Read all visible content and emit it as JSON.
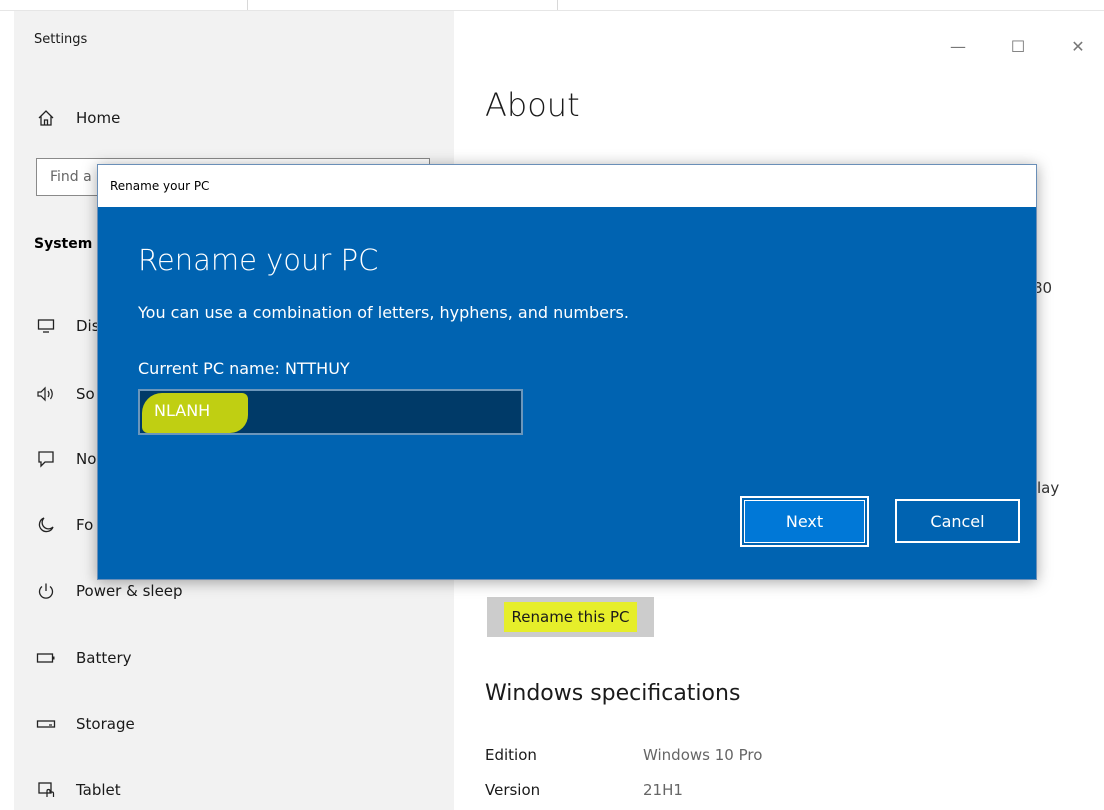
{
  "window": {
    "title": "Settings",
    "minimize_glyph": "—",
    "maximize_glyph": "☐",
    "close_glyph": "✕"
  },
  "sidebar": {
    "home_label": "Home",
    "search_placeholder": "Find a",
    "section_label": "System",
    "items": [
      {
        "label": "Display",
        "visible": "Dis",
        "icon": "monitor-icon"
      },
      {
        "label": "Sound",
        "visible": "So",
        "icon": "speaker-icon"
      },
      {
        "label": "Notifications",
        "visible": "No",
        "icon": "notification-icon"
      },
      {
        "label": "Focus assist",
        "visible": "Fo",
        "icon": "moon-icon"
      },
      {
        "label": "Power & sleep",
        "visible": "Power & sleep",
        "icon": "power-icon"
      },
      {
        "label": "Battery",
        "visible": "Battery",
        "icon": "battery-icon"
      },
      {
        "label": "Storage",
        "visible": "Storage",
        "icon": "storage-icon"
      },
      {
        "label": "Tablet",
        "visible": "Tablet",
        "icon": "tablet-icon"
      }
    ]
  },
  "main": {
    "title": "About",
    "partial_text_1": "80",
    "partial_text_2": "lay",
    "rename_button": "Rename this PC",
    "spec_title": "Windows specifications",
    "specs": [
      {
        "key": "Edition",
        "value": "Windows 10 Pro"
      },
      {
        "key": "Version",
        "value": "21H1"
      }
    ]
  },
  "dialog": {
    "window_title": "Rename your PC",
    "heading": "Rename your PC",
    "description": "You can use a combination of letters, hyphens, and numbers.",
    "current_name": "Current PC name: NTTHUY",
    "input_value": "NLANH",
    "next_label": "Next",
    "cancel_label": "Cancel"
  },
  "colors": {
    "dialog_blue": "#0063b1",
    "highlight_yellow": "#e6ee2a",
    "sidebar_bg": "#f2f2f2"
  }
}
